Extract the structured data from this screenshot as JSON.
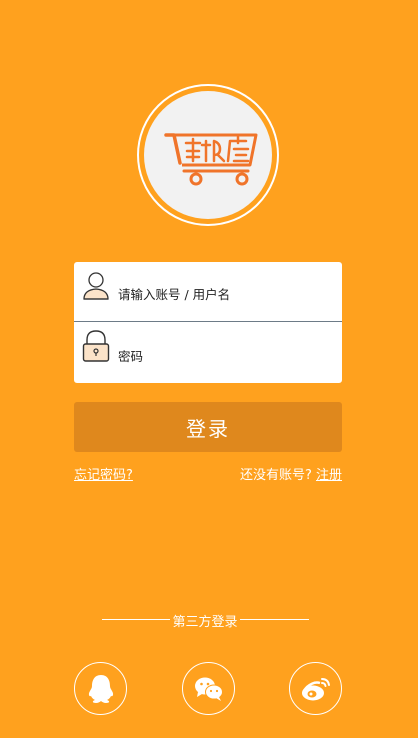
{
  "logo": {
    "icon": "shopping-cart-logo-icon",
    "color": "#f0742a"
  },
  "form": {
    "username_placeholder": "请输入账号 / 用户名",
    "password_placeholder": "密码",
    "username_icon": "user-icon",
    "password_icon": "lock-icon"
  },
  "actions": {
    "login_label": "登录",
    "forgot_label": "忘记密码?",
    "no_account_label": "还没有账号?",
    "register_label": "注册"
  },
  "third_party": {
    "label": "第三方登录",
    "providers": [
      {
        "icon": "qq-icon"
      },
      {
        "icon": "wechat-icon"
      },
      {
        "icon": "weibo-icon"
      }
    ]
  },
  "colors": {
    "background": "#ffa11e",
    "button": "#df881d",
    "logo_accent": "#f0742a"
  }
}
